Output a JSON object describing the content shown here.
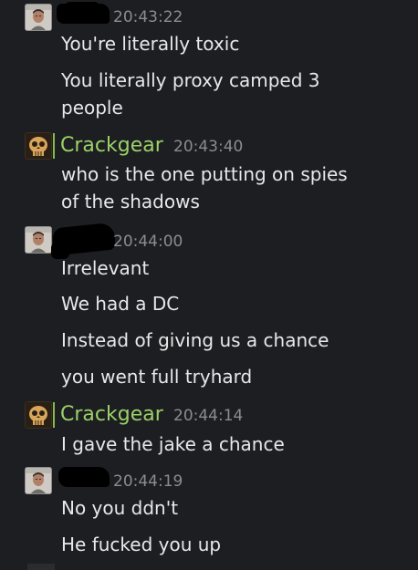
{
  "messages": [
    {
      "author": "",
      "avatar_icon": "user-photo-icon",
      "time": "20:43:22",
      "lines": [
        "You're literally toxic",
        "You literally proxy camped 3",
        "people"
      ]
    },
    {
      "author": "Crackgear",
      "avatar_icon": "crackgear-skull-icon",
      "time": "20:43:40",
      "lines": [
        "who is the one putting on spies",
        "of the shadows"
      ]
    },
    {
      "author": "",
      "avatar_icon": "user-photo-icon",
      "time": "20:44:00",
      "lines": [
        "Irrelevant",
        "We had a DC",
        "Instead of giving us a chance",
        "you went full tryhard"
      ]
    },
    {
      "author": "Crackgear",
      "avatar_icon": "crackgear-skull-icon",
      "time": "20:44:14",
      "lines": [
        "I gave the jake a chance"
      ]
    },
    {
      "author": "",
      "avatar_icon": "user-photo-icon",
      "time": "20:44:19",
      "lines": [
        "No you ddn't",
        "He fucked you up"
      ]
    }
  ],
  "colors": {
    "background": "#1d1e21",
    "author_name": "#9bd069",
    "timestamp": "#8a8c91",
    "message_text": "#e8e8ea",
    "redaction": "#000000"
  }
}
